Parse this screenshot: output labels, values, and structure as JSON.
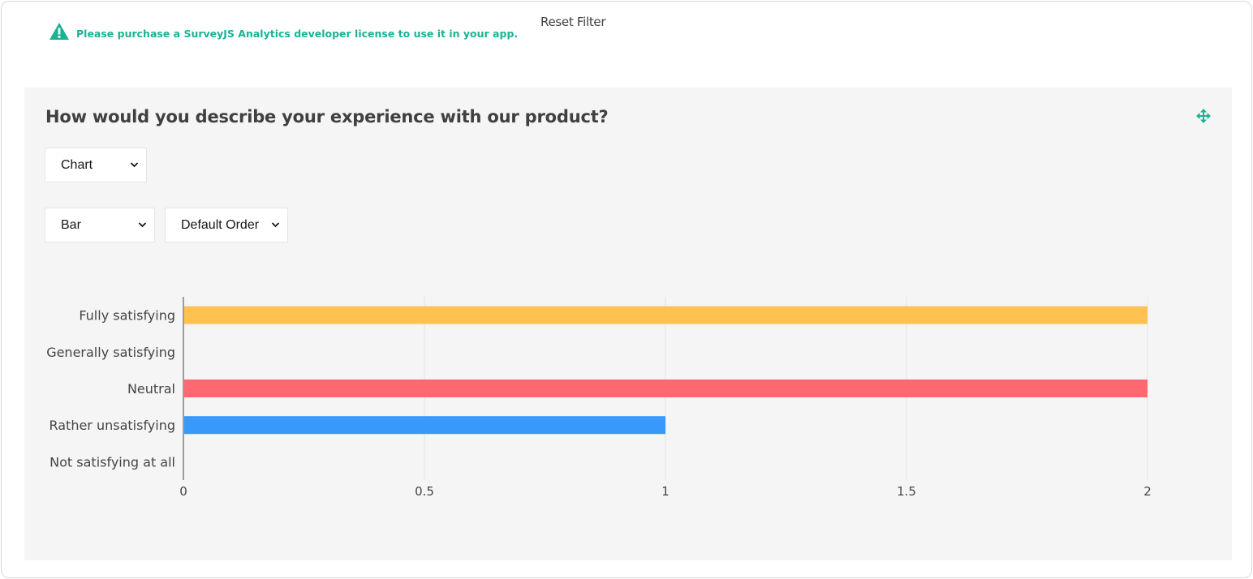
{
  "license": {
    "text": "Please purchase a SurveyJS Analytics developer license to use it in your app.",
    "icon": "warning-triangle-icon",
    "color": "#19b394"
  },
  "toolbar": {
    "reset_filter": "Reset Filter"
  },
  "question": {
    "title": "How would you describe your experience with our product?",
    "move_icon": "move-arrows-icon",
    "visualizer_select": "Chart",
    "chart_type_select": "Bar",
    "order_select": "Default Order"
  },
  "chart_data": {
    "type": "bar",
    "orientation": "horizontal",
    "categories": [
      "Fully satisfying",
      "Generally satisfying",
      "Neutral",
      "Rather unsatisfying",
      "Not satisfying at all"
    ],
    "values": [
      2,
      0,
      2,
      1,
      0
    ],
    "colors": [
      "#ffc152",
      "#ffffff",
      "#ff6771",
      "#3999fb",
      "#ffffff"
    ],
    "xlim": [
      0,
      2
    ],
    "xticks": [
      "0",
      "0.5",
      "1",
      "1.5",
      "2"
    ],
    "grid": true
  }
}
